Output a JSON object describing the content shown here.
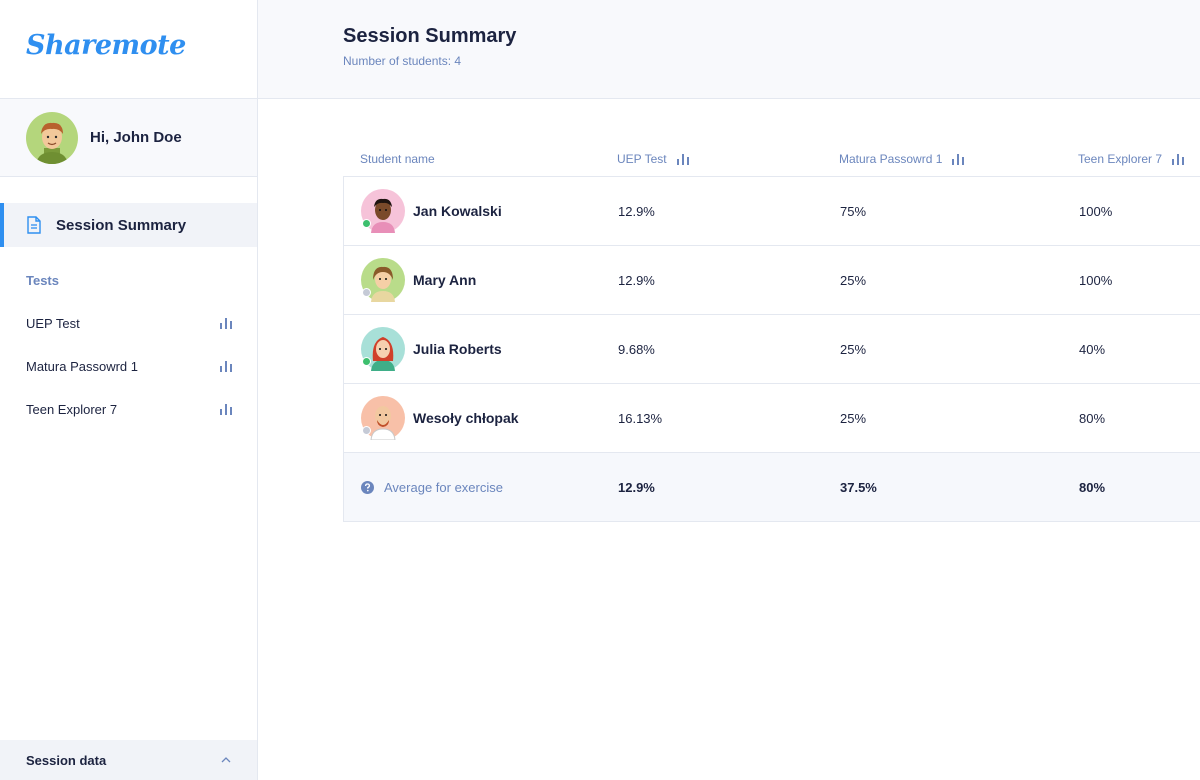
{
  "app": {
    "logo": "Sharemote"
  },
  "user": {
    "greeting": "Hi, John Doe"
  },
  "nav": {
    "active_label": "Session Summary"
  },
  "tests": {
    "heading": "Tests",
    "items": [
      {
        "label": "UEP Test"
      },
      {
        "label": "Matura Passowrd 1"
      },
      {
        "label": "Teen Explorer 7"
      }
    ]
  },
  "session_data": {
    "label": "Session data"
  },
  "header": {
    "title": "Session Summary",
    "subtitle": "Number of students: 4"
  },
  "table": {
    "columns": [
      "Student name",
      "UEP Test",
      "Matura Passowrd 1",
      "Teen Explorer 7"
    ],
    "rows": [
      {
        "name": "Jan Kowalski",
        "uep": "12.9%",
        "matura": "75%",
        "teen": "100%",
        "status": "online"
      },
      {
        "name": "Mary Ann",
        "uep": "12.9%",
        "matura": "25%",
        "teen": "100%",
        "status": "offline"
      },
      {
        "name": "Julia Roberts",
        "uep": "9.68%",
        "matura": "25%",
        "teen": "40%",
        "status": "online"
      },
      {
        "name": "Wesoły chłopak",
        "uep": "16.13%",
        "matura": "25%",
        "teen": "80%",
        "status": "offline"
      }
    ],
    "average": {
      "label": "Average for exercise",
      "uep": "12.9%",
      "matura": "37.5%",
      "teen": "80%"
    }
  },
  "colors": {
    "accent": "#2f8ff0",
    "muted": "#6b86bd",
    "online": "#3dbf6e",
    "offline": "#c5cad6"
  }
}
